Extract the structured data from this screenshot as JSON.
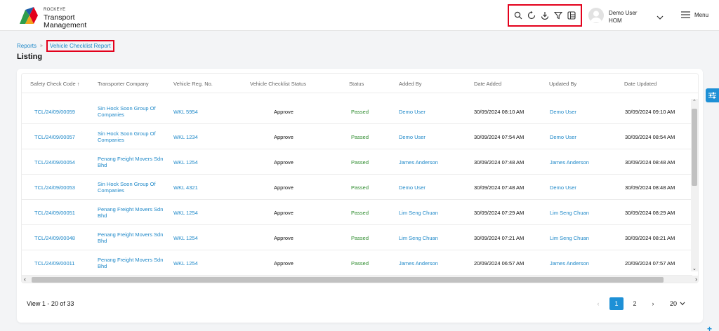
{
  "header": {
    "brand_small": "ROCKEYE",
    "brand_line1": "Transport",
    "brand_line2": "Management",
    "toolbar_icons": [
      "search-icon",
      "refresh-icon",
      "download-icon",
      "filter-icon",
      "column-layout-icon"
    ],
    "user_name": "Demo User",
    "user_role": "HOM",
    "menu_label": "Menu"
  },
  "breadcrumb": {
    "root": "Reports",
    "separator": "»",
    "current": "Vehicle Checklist Report"
  },
  "page_title": "Listing",
  "table": {
    "columns": [
      "Safety Check Code",
      "Transporter Company",
      "Vehicle Reg. No.",
      "Vehicle Checklist Status",
      "Status",
      "Added By",
      "Date Added",
      "Updated By",
      "Date Updated"
    ],
    "sort_indicator": "↑",
    "rows": [
      {
        "code": "TCL/24/09/00059",
        "company": "Sin Hock Soon Group Of Companies",
        "reg": "WKL 5954",
        "checklist": "Approve",
        "status": "Passed",
        "added_by": "Demo User",
        "date_added": "30/09/2024 08:10 AM",
        "updated_by": "Demo User",
        "date_updated": "30/09/2024 09:10 AM"
      },
      {
        "code": "TCL/24/09/00057",
        "company": "Sin Hock Soon Group Of Companies",
        "reg": "WKL 1234",
        "checklist": "Approve",
        "status": "Passed",
        "added_by": "Demo User",
        "date_added": "30/09/2024 07:54 AM",
        "updated_by": "Demo User",
        "date_updated": "30/09/2024 08:54 AM"
      },
      {
        "code": "TCL/24/09/00054",
        "company": "Penang Freight Movers Sdn Bhd",
        "reg": "WKL 1254",
        "checklist": "Approve",
        "status": "Passed",
        "added_by": "James Anderson",
        "date_added": "30/09/2024 07:48 AM",
        "updated_by": "James Anderson",
        "date_updated": "30/09/2024 08:48 AM"
      },
      {
        "code": "TCL/24/09/00053",
        "company": "Sin Hock Soon Group Of Companies",
        "reg": "WKL 4321",
        "checklist": "Approve",
        "status": "Passed",
        "added_by": "Demo User",
        "date_added": "30/09/2024 07:48 AM",
        "updated_by": "Demo User",
        "date_updated": "30/09/2024 08:48 AM"
      },
      {
        "code": "TCL/24/09/00051",
        "company": "Penang Freight Movers Sdn Bhd",
        "reg": "WKL 1254",
        "checklist": "Approve",
        "status": "Passed",
        "added_by": "Lim Seng Chuan",
        "date_added": "30/09/2024 07:29 AM",
        "updated_by": "Lim Seng Chuan",
        "date_updated": "30/09/2024 08:29 AM"
      },
      {
        "code": "TCL/24/09/00048",
        "company": "Penang Freight Movers Sdn Bhd",
        "reg": "WKL 1254",
        "checklist": "Approve",
        "status": "Passed",
        "added_by": "Lim Seng Chuan",
        "date_added": "30/09/2024 07:21 AM",
        "updated_by": "Lim Seng Chuan",
        "date_updated": "30/09/2024 08:21 AM"
      },
      {
        "code": "TCL/24/09/00011",
        "company": "Penang Freight Movers Sdn Bhd",
        "reg": "WKL 1254",
        "checklist": "Approve",
        "status": "Passed",
        "added_by": "James Anderson",
        "date_added": "20/09/2024 06:57 AM",
        "updated_by": "James Anderson",
        "date_updated": "20/09/2024 07:57 AM"
      }
    ]
  },
  "footer_bar": {
    "view_count": "View 1 - 20 of 33",
    "pages": [
      "1",
      "2"
    ],
    "active_page": "1",
    "per_page": "20"
  },
  "colors": {
    "accent": "#1e90d6",
    "link": "#1e88c8",
    "passed": "#2e8b2e",
    "highlight_border": "#e3001b"
  }
}
